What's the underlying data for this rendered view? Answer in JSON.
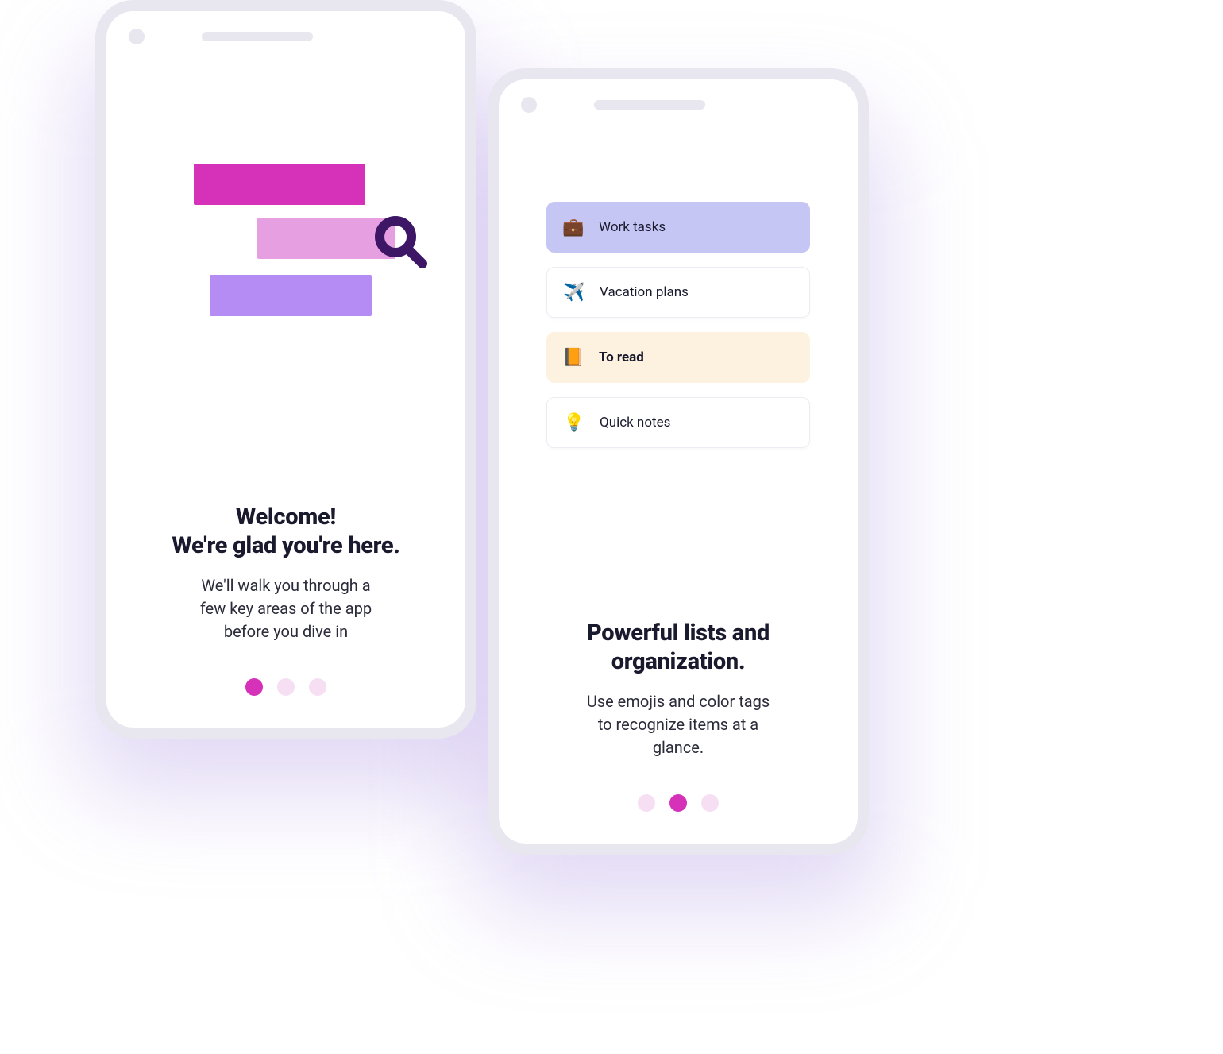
{
  "phone1": {
    "headline": "Welcome!\nWe're glad you're here.",
    "subcopy": "We'll walk you through a\nfew key areas of the app\nbefore you dive in",
    "dots": {
      "count": 3,
      "active_index": 0
    }
  },
  "phone2": {
    "items": [
      {
        "emoji": "💼",
        "label": "Work tasks",
        "variant": "purple"
      },
      {
        "emoji": "✈️",
        "label": "Vacation plans",
        "variant": "card"
      },
      {
        "emoji": "📙",
        "label": "To read",
        "variant": "cream"
      },
      {
        "emoji": "💡",
        "label": "Quick notes",
        "variant": "card"
      }
    ],
    "headline": "Powerful lists and\norganization.",
    "subcopy": "Use emojis and color tags\nto recognize items at a\nglance.",
    "dots": {
      "count": 3,
      "active_index": 1
    }
  },
  "colors": {
    "accent": "#d631b9",
    "bar_pink_light": "#e69fe0",
    "bar_lilac": "#b58bf4",
    "list_purple": "#c6c6f5",
    "list_cream": "#fdf2df"
  }
}
